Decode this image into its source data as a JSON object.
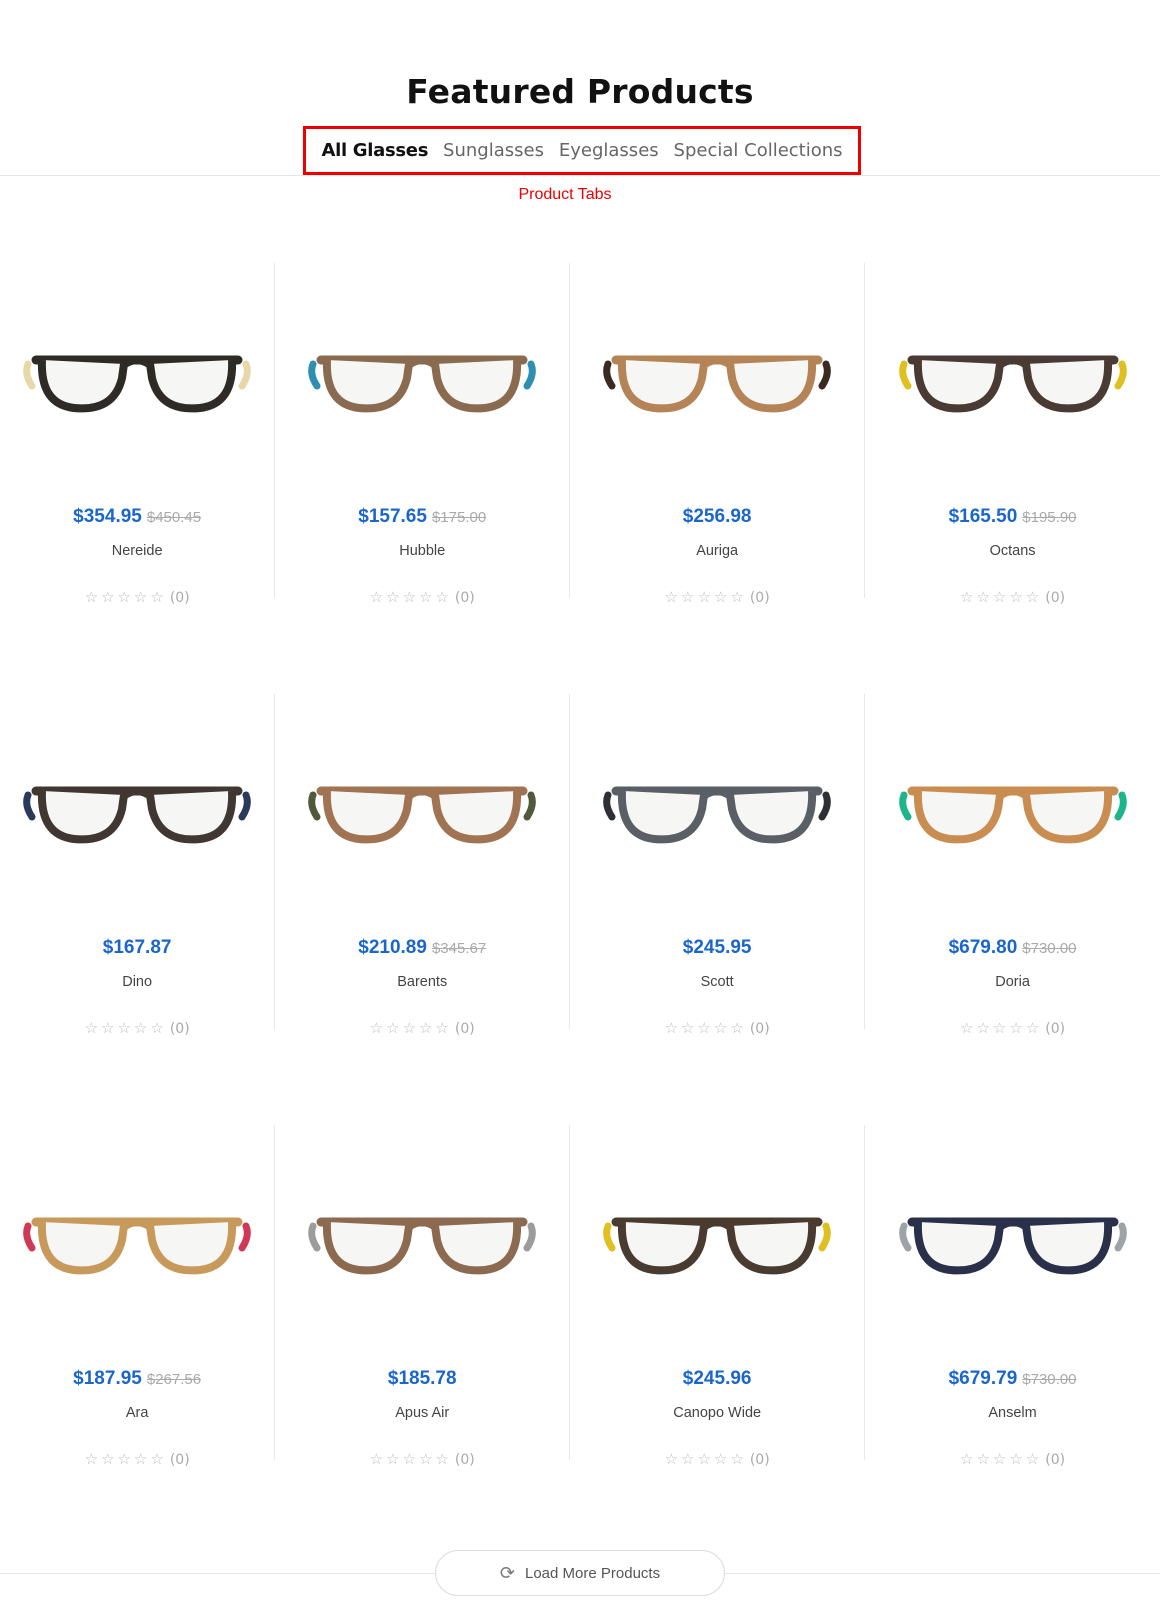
{
  "section": {
    "title": "Featured Products"
  },
  "tabs": [
    {
      "label": "All Glasses",
      "active": true
    },
    {
      "label": "Sunglasses",
      "active": false
    },
    {
      "label": "Eyeglasses",
      "active": false
    },
    {
      "label": "Special Collections",
      "active": false
    }
  ],
  "annotation": "Product Tabs",
  "colors": {
    "accent": "#1a66cc",
    "highlight": "#ee0000"
  },
  "rating_stars": "☆☆☆☆☆",
  "products": [
    {
      "name": "Nereide",
      "price": "$354.95",
      "old_price": "$450.45",
      "reviews": "(0)",
      "frame": "#2e2b26",
      "temple": "#e8d7a8"
    },
    {
      "name": "Hubble",
      "price": "$157.65",
      "old_price": "$175.00",
      "reviews": "(0)",
      "frame": "#8a6b4f",
      "temple": "#2f8fb0"
    },
    {
      "name": "Auriga",
      "price": "$256.98",
      "old_price": "",
      "reviews": "(0)",
      "frame": "#b48456",
      "temple": "#3b2a22"
    },
    {
      "name": "Octans",
      "price": "$165.50",
      "old_price": "$195.90",
      "reviews": "(0)",
      "frame": "#4a3a34",
      "temple": "#e0c020"
    },
    {
      "name": "Dino",
      "price": "$167.87",
      "old_price": "",
      "reviews": "(0)",
      "frame": "#403732",
      "temple": "#2a3a5a"
    },
    {
      "name": "Barents",
      "price": "$210.89",
      "old_price": "$345.67",
      "reviews": "(0)",
      "frame": "#a07352",
      "temple": "#505a3a"
    },
    {
      "name": "Scott",
      "price": "$245.95",
      "old_price": "",
      "reviews": "(0)",
      "frame": "#5a5f66",
      "temple": "#2c2f34"
    },
    {
      "name": "Doria",
      "price": "$679.80",
      "old_price": "$730.00",
      "reviews": "(0)",
      "frame": "#c98d52",
      "temple": "#1fb58a"
    },
    {
      "name": "Ara",
      "price": "$187.95",
      "old_price": "$267.56",
      "reviews": "(0)",
      "frame": "#c79a5c",
      "temple": "#d03858"
    },
    {
      "name": "Apus Air",
      "price": "$185.78",
      "old_price": "",
      "reviews": "(0)",
      "frame": "#8c6a50",
      "temple": "#9c9c9c"
    },
    {
      "name": "Canopo Wide",
      "price": "$245.96",
      "old_price": "",
      "reviews": "(0)",
      "frame": "#4a3b30",
      "temple": "#e0c020"
    },
    {
      "name": "Anselm",
      "price": "$679.79",
      "old_price": "$730.00",
      "reviews": "(0)",
      "frame": "#2a2f4a",
      "temple": "#9ea3a8"
    }
  ],
  "load_more": {
    "label": "Load More Products",
    "icon": "refresh-icon"
  }
}
